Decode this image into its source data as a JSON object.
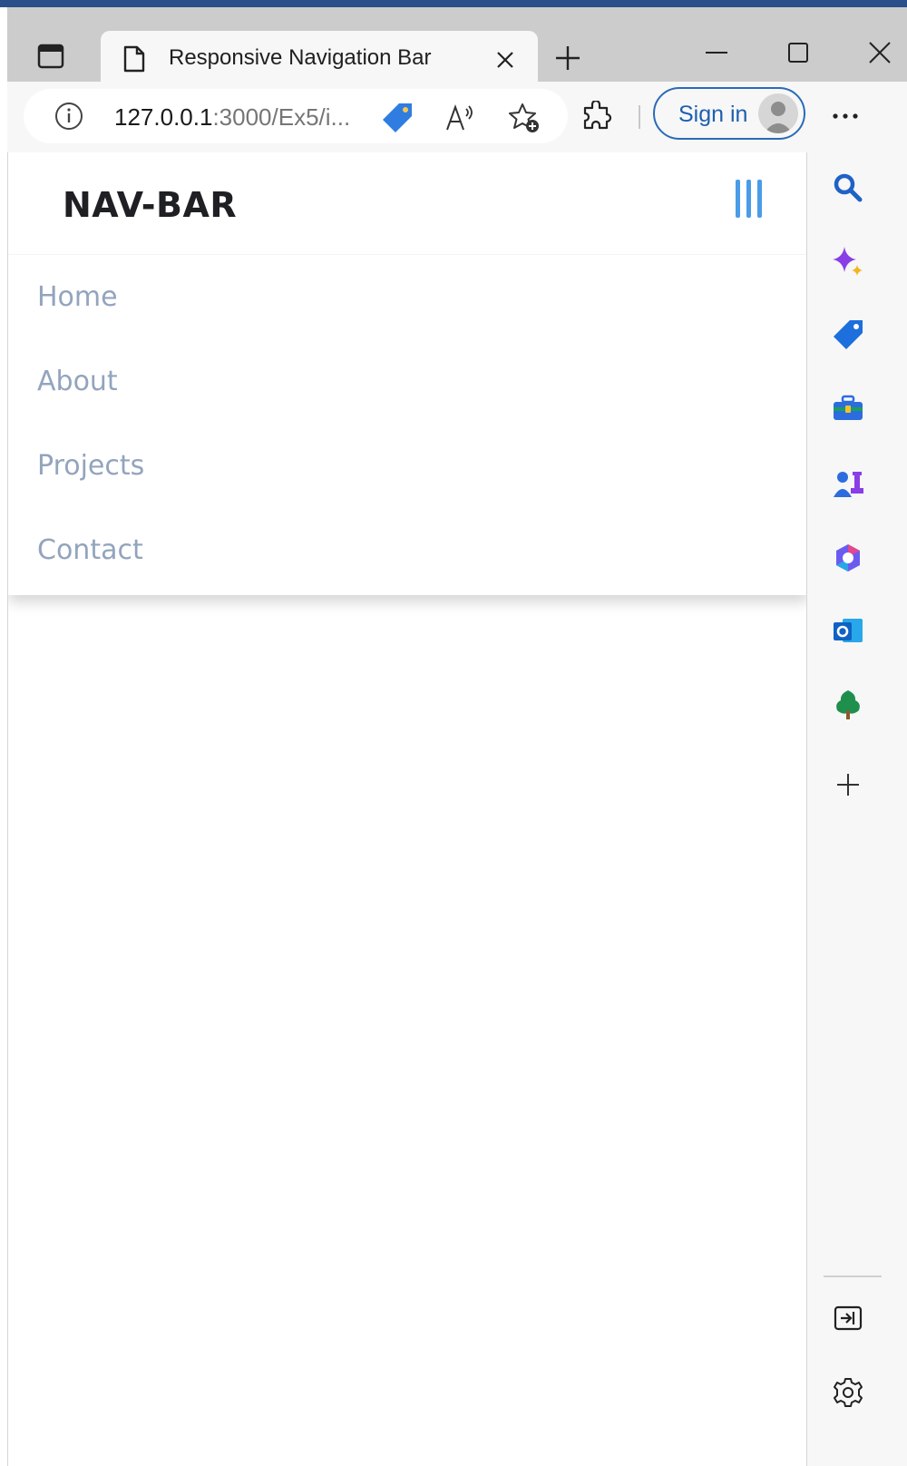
{
  "browser": {
    "tab": {
      "title": "Responsive Navigation Bar"
    },
    "address": {
      "host": "127.0.0.1",
      "rest": ":3000/Ex5/i..."
    },
    "sign_in_label": "Sign in"
  },
  "page": {
    "brand": "NAV-BAR",
    "nav_links": [
      {
        "label": "Home"
      },
      {
        "label": "About"
      },
      {
        "label": "Projects"
      },
      {
        "label": "Contact"
      }
    ]
  },
  "sidebar": {
    "items": [
      {
        "icon": "search-icon"
      },
      {
        "icon": "copilot-sparkle-icon"
      },
      {
        "icon": "shopping-tag-icon"
      },
      {
        "icon": "tools-icon"
      },
      {
        "icon": "games-icon"
      },
      {
        "icon": "microsoft-365-icon"
      },
      {
        "icon": "outlook-icon"
      },
      {
        "icon": "tree-icon"
      },
      {
        "icon": "add-icon"
      }
    ],
    "bottom": [
      {
        "icon": "hide-sidebar-icon"
      },
      {
        "icon": "settings-icon"
      }
    ]
  },
  "colors": {
    "accent": "#4a9ce8",
    "link": "#93a4bd",
    "brand_text": "#1f2024",
    "sign_in_border": "#2a6bb7"
  }
}
